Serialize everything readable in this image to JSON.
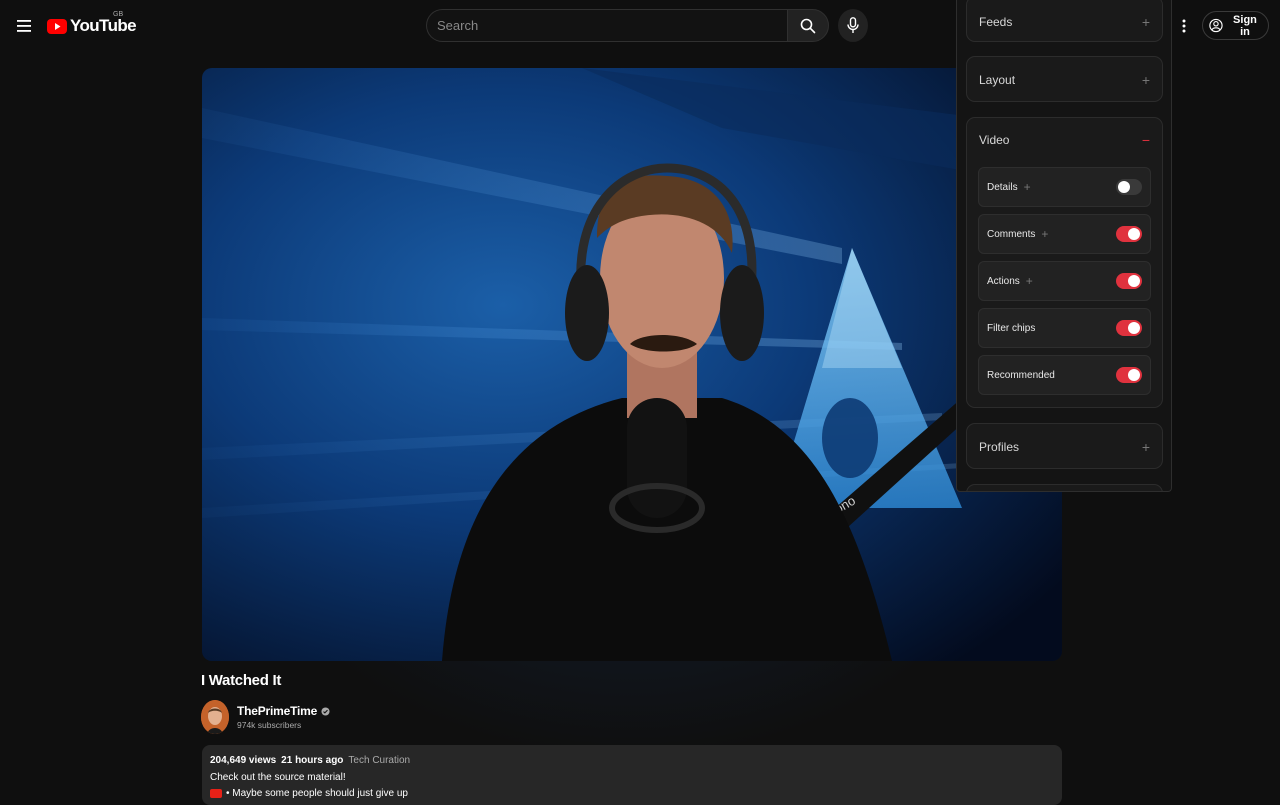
{
  "header": {
    "logo_text": "YouTube",
    "country_code": "GB",
    "search_placeholder": "Search",
    "signin_label": "Sign in"
  },
  "video": {
    "title": "I Watched It",
    "channel_name": "ThePrimeTime",
    "subscribers": "974k subscribers",
    "views": "204,649 views",
    "age": "21 hours ago",
    "tag": "Tech Curation",
    "description_line1": "Check out the source material!",
    "description_line2": "• Maybe some people should just give up"
  },
  "panel": {
    "sections": {
      "feeds": "Feeds",
      "layout": "Layout",
      "video": "Video",
      "profiles": "Profiles"
    },
    "video_options": [
      {
        "label": "Details",
        "has_plus": true,
        "enabled": false
      },
      {
        "label": "Comments",
        "has_plus": true,
        "enabled": true
      },
      {
        "label": "Actions",
        "has_plus": true,
        "enabled": true
      },
      {
        "label": "Filter chips",
        "has_plus": false,
        "enabled": true
      },
      {
        "label": "Recommended",
        "has_plus": false,
        "enabled": true
      }
    ],
    "colors": {
      "accent": "#e0323e",
      "toggle_off": "#3a3a3a"
    }
  },
  "icons": {
    "menu": "menu-icon",
    "search": "search-icon",
    "mic": "mic-icon",
    "more": "more-vert-icon",
    "account": "account-icon",
    "verified": "verified-icon"
  }
}
